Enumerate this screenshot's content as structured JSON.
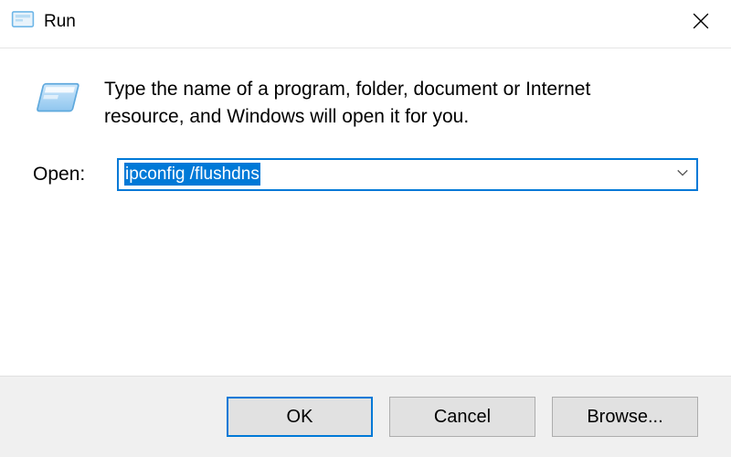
{
  "title": "Run",
  "description": "Type the name of a program, folder, document or Internet resource, and Windows will open it for you.",
  "open": {
    "label": "Open:",
    "value": "ipconfig /flushdns"
  },
  "buttons": {
    "ok": "OK",
    "cancel": "Cancel",
    "browse": "Browse..."
  },
  "icons": {
    "app": "run-dialog-icon",
    "close": "close-icon",
    "dropdown": "chevron-down-icon",
    "body": "run-dialog-large-icon"
  }
}
